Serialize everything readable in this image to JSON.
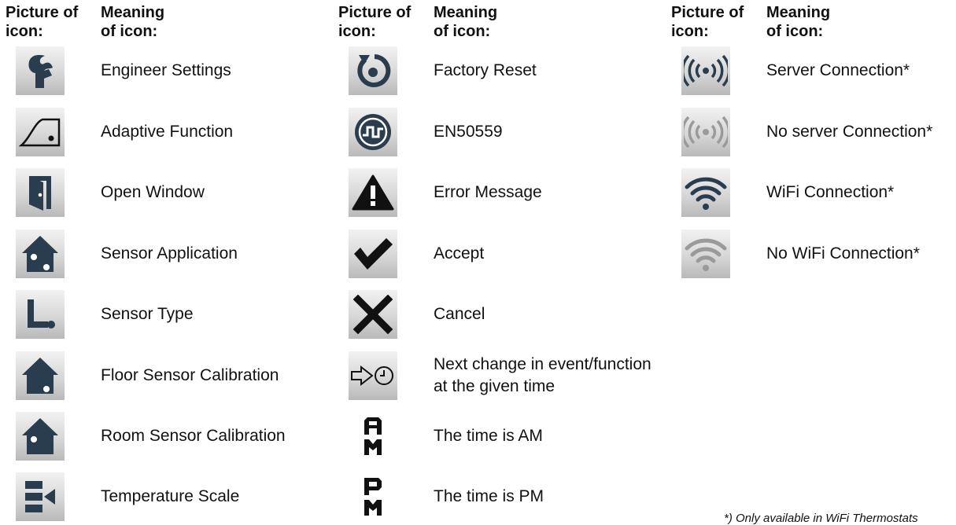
{
  "headers": {
    "picture": [
      "Picture of",
      "icon:"
    ],
    "meaning": [
      "Meaning",
      "of icon:"
    ]
  },
  "columns": [
    {
      "items": [
        {
          "icon": "wrench-icon",
          "label": "Engineer Settings"
        },
        {
          "icon": "adaptive-function-icon",
          "label": "Adaptive Function"
        },
        {
          "icon": "open-window-icon",
          "label": "Open Window"
        },
        {
          "icon": "sensor-application-icon",
          "label": "Sensor Application"
        },
        {
          "icon": "sensor-type-icon",
          "label": "Sensor Type"
        },
        {
          "icon": "floor-sensor-icon",
          "label": "Floor Sensor Calibration"
        },
        {
          "icon": "room-sensor-icon",
          "label": "Room Sensor Calibration"
        },
        {
          "icon": "temperature-scale-icon",
          "label": "Temperature Scale"
        }
      ]
    },
    {
      "items": [
        {
          "icon": "factory-reset-icon",
          "label": "Factory Reset"
        },
        {
          "icon": "en50559-icon",
          "label": "EN50559"
        },
        {
          "icon": "error-warning-icon",
          "label": "Error Message"
        },
        {
          "icon": "checkmark-icon",
          "label": "Accept"
        },
        {
          "icon": "cross-icon",
          "label": "Cancel"
        },
        {
          "icon": "next-change-clock-icon",
          "label": "Next change in event/function",
          "label2": "at the given time"
        },
        {
          "icon": "am-icon",
          "label": "The time is AM"
        },
        {
          "icon": "pm-icon",
          "label": "The time is PM"
        }
      ]
    },
    {
      "items": [
        {
          "icon": "server-connection-icon",
          "label": "Server Connection*"
        },
        {
          "icon": "no-server-connection-icon",
          "label": "No server Connection*"
        },
        {
          "icon": "wifi-connection-icon",
          "label": "WiFi Connection*"
        },
        {
          "icon": "no-wifi-connection-icon",
          "label": "No WiFi Connection*"
        }
      ]
    }
  ],
  "footnote": "*) Only available in WiFi Thermostats",
  "colors": {
    "icon_dark": "#2a3d4e",
    "icon_black": "#111111",
    "icon_faded": "#9a9a9a"
  }
}
